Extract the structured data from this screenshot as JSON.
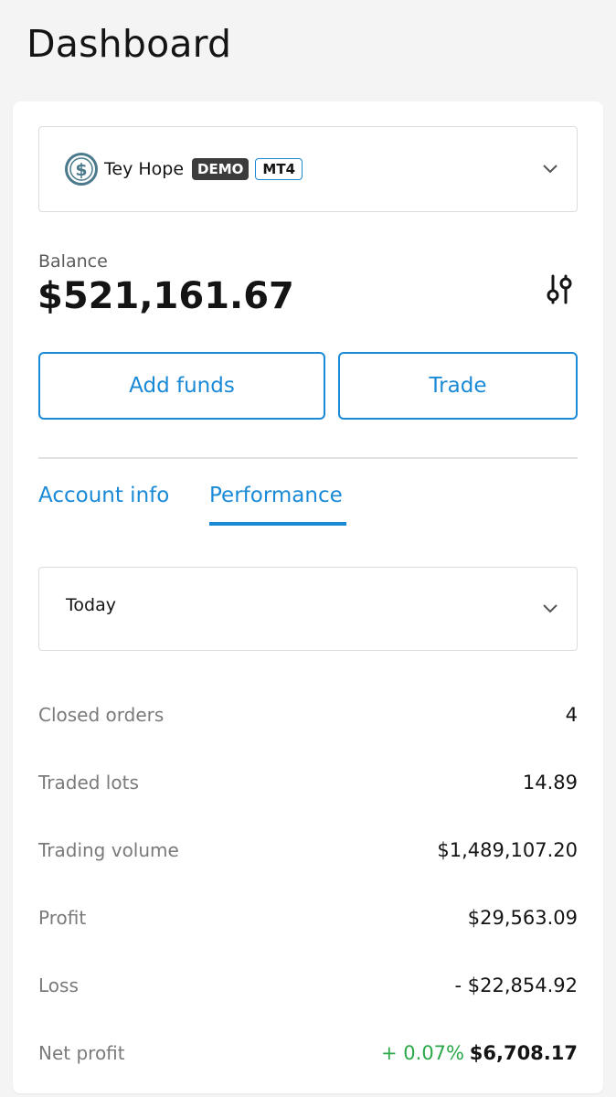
{
  "page": {
    "title": "Dashboard"
  },
  "account": {
    "name": "Tey Hope",
    "badge_type": "DEMO",
    "badge_platform": "MT4",
    "icon": "dollar-circle-icon",
    "dropdown_icon": "chevron-down-icon"
  },
  "balance": {
    "label": "Balance",
    "value": "$521,161.67",
    "settings_icon": "sliders-icon"
  },
  "actions": {
    "add_funds": "Add funds",
    "trade": "Trade"
  },
  "tabs": [
    {
      "label": "Account info",
      "active": false
    },
    {
      "label": "Performance",
      "active": true
    }
  ],
  "period": {
    "selected": "Today"
  },
  "stats": [
    {
      "label": "Closed orders",
      "value": "4"
    },
    {
      "label": "Traded lots",
      "value": "14.89"
    },
    {
      "label": "Trading volume",
      "value": "$1,489,107.20"
    },
    {
      "label": "Profit",
      "value": "$29,563.09"
    },
    {
      "label": "Loss",
      "value": "- $22,854.92"
    }
  ],
  "net_profit": {
    "label": "Net profit",
    "percent": "+ 0.07%",
    "value": "$6,708.17"
  },
  "colors": {
    "accent": "#1a8ad6",
    "positive": "#2aa84a",
    "badge_dark": "#3c3c3c"
  }
}
